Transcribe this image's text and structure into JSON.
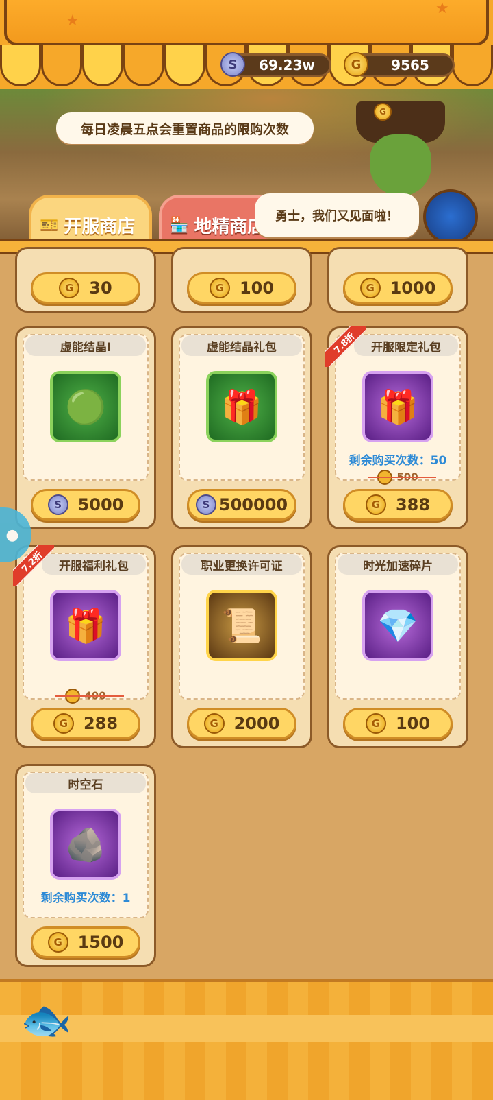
{
  "currency": {
    "silver": {
      "value": "69.23w",
      "icon": "silver-coin-icon"
    },
    "gold": {
      "value": "9565",
      "icon": "gold-coin-icon"
    }
  },
  "notice": "每日凌晨五点会重置商品的限购次数",
  "greeting": "勇士，我们又见面啦！",
  "tabs": [
    {
      "label": "开服商店",
      "icon": "ticket-icon"
    },
    {
      "label": "地精商店",
      "icon": "shop-icon"
    }
  ],
  "partial_prices": [
    "30",
    "100",
    "1000"
  ],
  "items": [
    {
      "title": "虚能结晶Ⅰ",
      "price": "5000",
      "currency": "silver",
      "icon": "green-crystal-icon"
    },
    {
      "title": "虚能结晶礼包",
      "price": "500000",
      "currency": "silver",
      "icon": "green-gift-icon"
    },
    {
      "title": "开服限定礼包",
      "price": "388",
      "currency": "gold",
      "icon": "mystery-gift-icon",
      "discount": "7.8折",
      "remaining": "剩余购买次数：50",
      "old_price": "500"
    },
    {
      "title": "开服福利礼包",
      "price": "288",
      "currency": "gold",
      "icon": "mystery-gift-icon",
      "discount": "7.2折",
      "old_price": "400"
    },
    {
      "title": "职业更换许可证",
      "price": "2000",
      "currency": "gold",
      "icon": "scroll-icon"
    },
    {
      "title": "时光加速碎片",
      "price": "100",
      "currency": "gold",
      "icon": "blue-crystal-icon"
    },
    {
      "title": "时空石",
      "price": "1500",
      "currency": "gold",
      "icon": "purple-stone-icon",
      "remaining": "剩余购买次数：1"
    }
  ],
  "colors": {
    "accent": "#f6a82a",
    "remaining_text": "#2d8ad6",
    "discount_ribbon": "#e03d2a"
  }
}
